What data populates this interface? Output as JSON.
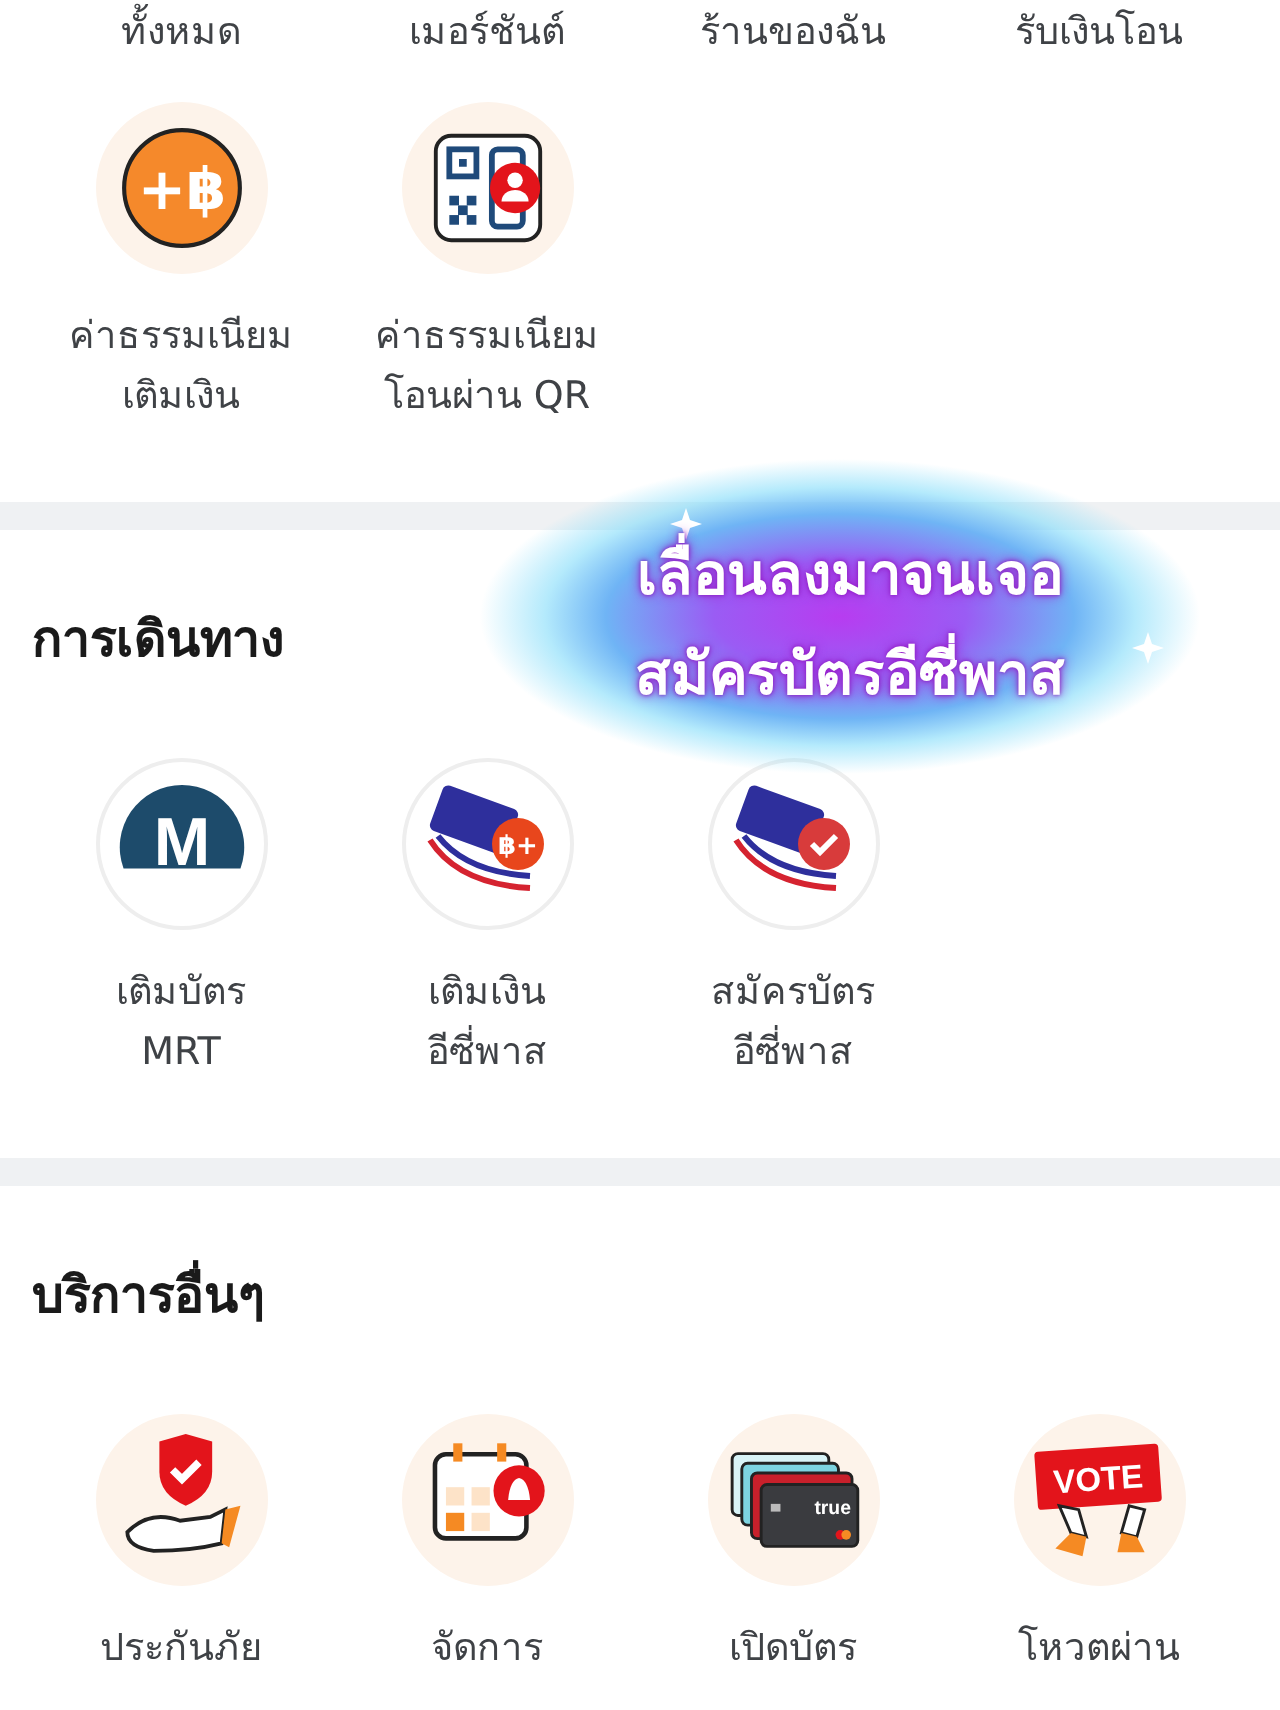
{
  "sections": [
    {
      "items": [
        {
          "label": "ทั้งหมด"
        },
        {
          "label": "เมอร์ชันต์"
        },
        {
          "label": "ร้านของฉัน"
        },
        {
          "label": "รับเงินโอน"
        },
        {
          "kind": "baht-plus",
          "icon_text": "+฿",
          "label": "ค่าธรรมเนียม\nเติมเงิน"
        },
        {
          "kind": "qr-person",
          "label": "ค่าธรรมเนียม\nโอนผ่าน QR"
        }
      ]
    },
    {
      "title": "การเดินทาง",
      "items": [
        {
          "kind": "metro",
          "icon_text": "M",
          "label": "เติมบัตร\nMRT"
        },
        {
          "kind": "card-topup",
          "icon_text": "฿+",
          "label": "เติมเงิน\nอีซี่พาส"
        },
        {
          "kind": "card-check",
          "label": "สมัครบัตร\nอีซี่พาส"
        }
      ]
    },
    {
      "title": "บริการอื่นๆ",
      "items": [
        {
          "kind": "shield-hand",
          "label": "ประกันภัย"
        },
        {
          "kind": "calendar-bell",
          "label": "จัดการ"
        },
        {
          "kind": "cards",
          "icon_text": "true",
          "label": "เปิดบัตร"
        },
        {
          "kind": "vote",
          "icon_text": "VOTE",
          "label": "โหวตผ่าน"
        }
      ]
    }
  ],
  "overlay": {
    "text": "เลื่อนลงมาจนเจอ\nสมัครบัตรอีซี่พาส"
  }
}
